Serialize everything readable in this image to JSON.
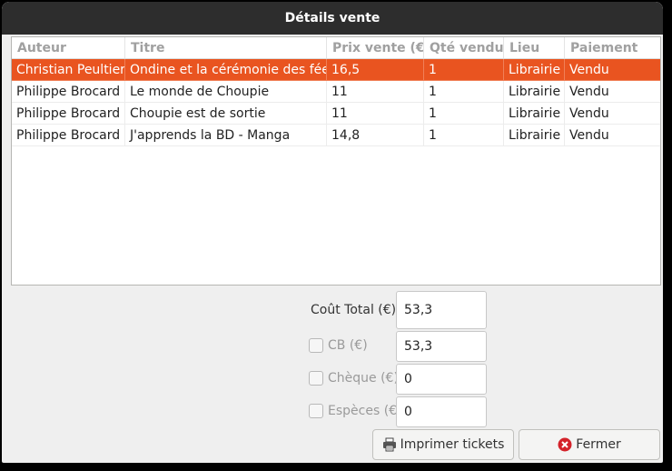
{
  "window": {
    "title": "Détails vente"
  },
  "table": {
    "columns": [
      "Auteur",
      "Titre",
      "Prix vente (€)",
      "Qté vendu",
      "Lieu",
      "Paiement"
    ],
    "rows": [
      [
        "Christian Peultier",
        "Ondine et la cérémonie des fées",
        "16,5",
        "1",
        "Librairie",
        "Vendu"
      ],
      [
        "Philippe Brocard",
        "Le monde de Choupie",
        "11",
        "1",
        "Librairie",
        "Vendu"
      ],
      [
        "Philippe Brocard",
        "Choupie est de sortie",
        "11",
        "1",
        "Librairie",
        "Vendu"
      ],
      [
        "Philippe Brocard",
        "J'apprends la BD - Manga",
        "14,8",
        "1",
        "Librairie",
        "Vendu"
      ]
    ],
    "selected_row": 0
  },
  "form": {
    "total_label": "Coût Total (€)",
    "total_value": "53,3",
    "cb_label": "CB (€)",
    "cb_value": "53,3",
    "cheque_label": "Chèque (€)",
    "cheque_value": "0",
    "especes_label": "Espèces (€)",
    "especes_value": "0"
  },
  "buttons": {
    "print_label": "Imprimer tickets",
    "print_icon": "printer-icon",
    "close_label": "Fermer",
    "close_icon": "close-circle-icon"
  },
  "colors": {
    "selection": "#e95420",
    "titlebar": "#2d2d2d",
    "close_icon": "#d4222a"
  }
}
